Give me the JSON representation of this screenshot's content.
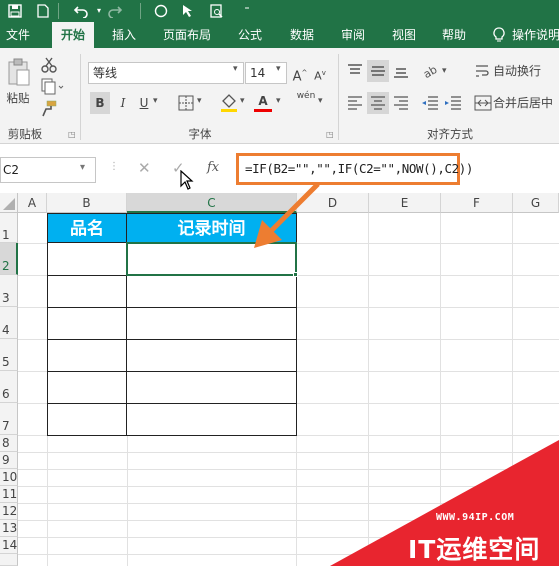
{
  "quick_access": {
    "save_icon": "save-icon",
    "new_icon": "new-file-icon",
    "undo_icon": "undo-icon",
    "redo_icon": "redo-icon",
    "circle_icon": "circle-icon",
    "select_icon": "select-icon",
    "preview_icon": "print-preview-icon",
    "customize_icon": "customize-icon"
  },
  "menu": {
    "items": [
      "文件",
      "开始",
      "插入",
      "页面布局",
      "公式",
      "数据",
      "审阅",
      "视图",
      "帮助",
      "操作说明"
    ],
    "active_index": 1
  },
  "ribbon": {
    "clipboard": {
      "paste_label": "粘贴",
      "group_label": "剪贴板"
    },
    "font": {
      "font_name": "等线",
      "font_size": "14",
      "bold": "B",
      "italic": "I",
      "underline": "U",
      "font_color": "A",
      "wen": "wén",
      "group_label": "字体"
    },
    "alignment": {
      "wrap_label": "自动换行",
      "merge_label": "合并后居中",
      "group_label": "对齐方式"
    }
  },
  "formula_bar": {
    "name_box": "C2",
    "fx": "fx",
    "formula": "=IF(B2=\"\",\"\",IF(C2=\"\",NOW(),C2))"
  },
  "sheet": {
    "columns": [
      "A",
      "B",
      "C",
      "D",
      "E",
      "F",
      "G"
    ],
    "rows": [
      "1",
      "2",
      "3",
      "4",
      "5",
      "6",
      "7",
      "8",
      "9",
      "10",
      "11",
      "12",
      "13",
      "14"
    ],
    "selected_cell": "C2",
    "table_headers": [
      "品名",
      "记录时间"
    ]
  },
  "watermark": {
    "url": "WWW.94IP.COM",
    "brand": "IT运维空间",
    "color": "#e8252f"
  },
  "colors": {
    "excel_green": "#217346",
    "header_blue": "#00b0f0",
    "annotation_orange": "#ed7d31"
  }
}
